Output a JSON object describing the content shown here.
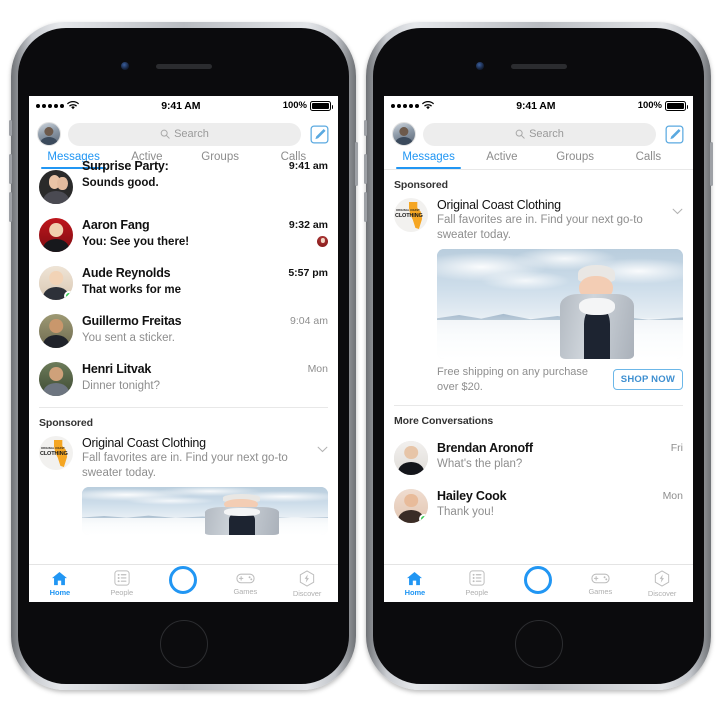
{
  "status_bar": {
    "signal_icon": "signal-dots-icon",
    "wifi_icon": "wifi-icon",
    "time": "9:41 AM",
    "battery_percent": "100%",
    "battery_icon": "battery-full-icon"
  },
  "header": {
    "avatar_name": "profile-avatar",
    "search_placeholder": "Search",
    "search_icon": "search-icon",
    "compose_icon": "compose-icon",
    "tabs": [
      {
        "label": "Messages",
        "active": true
      },
      {
        "label": "Active",
        "active": false
      },
      {
        "label": "Groups",
        "active": false
      },
      {
        "label": "Calls",
        "active": false
      }
    ]
  },
  "left_phone": {
    "conversations": [
      {
        "name": "Surprise Party:",
        "preview": "Sounds good.",
        "time": "9:41 am",
        "unread": true,
        "online": false,
        "clipped": true
      },
      {
        "name": "Aaron Fang",
        "preview": "You: See you there!",
        "time": "9:32 am",
        "unread": true,
        "online": false,
        "read_receipt": true
      },
      {
        "name": "Aude Reynolds",
        "preview": "That works for me",
        "time": "5:57 pm",
        "unread": true,
        "online": true
      },
      {
        "name": "Guillermo Freitas",
        "preview": "You sent a sticker.",
        "time": "9:04 am",
        "unread": false,
        "online": false
      },
      {
        "name": "Henri Litvak",
        "preview": "Dinner tonight?",
        "time": "Mon",
        "unread": false,
        "online": false
      }
    ],
    "sponsored_label": "Sponsored",
    "ad": {
      "advertiser": "Original Coast Clothing",
      "logo_icon": "original-coast-clothing-logo",
      "body": "Fall favorites are in. Find your next go-to sweater today.",
      "chevron_icon": "chevron-down-icon",
      "image_alt": "woman-in-winter-coat-photo"
    }
  },
  "right_phone": {
    "sponsored_label": "Sponsored",
    "ad": {
      "advertiser": "Original Coast Clothing",
      "logo_icon": "original-coast-clothing-logo",
      "body": "Fall favorites are in. Find your next go-to sweater today.",
      "chevron_icon": "chevron-down-icon",
      "image_alt": "woman-in-winter-coat-photo",
      "offer_text": "Free shipping on any purchase over $20.",
      "cta_label": "SHOP NOW"
    },
    "more_label": "More Conversations",
    "conversations": [
      {
        "name": "Brendan Aronoff",
        "preview": "What's the plan?",
        "time": "Fri",
        "unread": false,
        "online": false
      },
      {
        "name": "Hailey Cook",
        "preview": "Thank you!",
        "time": "Mon",
        "unread": false,
        "online": true
      }
    ]
  },
  "tabbar": {
    "items": [
      {
        "label": "Home",
        "icon": "home-icon",
        "active": true
      },
      {
        "label": "People",
        "icon": "people-list-icon",
        "active": false
      },
      {
        "label": "Camera",
        "icon": "camera-ring-icon",
        "active": false
      },
      {
        "label": "Games",
        "icon": "gamepad-icon",
        "active": false
      },
      {
        "label": "Discover",
        "icon": "discover-icon",
        "active": false
      }
    ]
  },
  "colors": {
    "accent": "#2196f3",
    "online": "#2fd14f",
    "logo_orange": "#f5a623",
    "cta_border": "#6cb7e8",
    "cta_text": "#3e8fd0"
  }
}
